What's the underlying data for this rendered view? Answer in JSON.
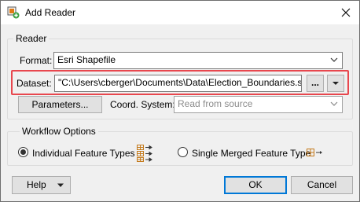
{
  "window": {
    "title": "Add Reader",
    "close_icon": "close-icon",
    "app_icon": "add-reader-app-icon"
  },
  "reader": {
    "group_label": "Reader",
    "format_label": "Format:",
    "format_value": "Esri Shapefile",
    "dataset_label": "Dataset:",
    "dataset_value": "\"C:\\Users\\cberger\\Documents\\Data\\Election_Boundaries.shp\"",
    "browse_label": "...",
    "parameters_label": "Parameters...",
    "coord_label": "Coord. System:",
    "coord_placeholder": "Read from source",
    "highlight_color": "#e8474e"
  },
  "workflow": {
    "group_label": "Workflow Options",
    "option1_label": "Individual Feature Types",
    "option1_selected": true,
    "option1_icon": "individual-feature-types-icon",
    "option2_label": "Single Merged Feature Type",
    "option2_selected": false,
    "option2_icon": "single-merged-feature-type-icon",
    "accent_color": "#c47a1c"
  },
  "footer": {
    "help_label": "Help",
    "ok_label": "OK",
    "cancel_label": "Cancel"
  }
}
